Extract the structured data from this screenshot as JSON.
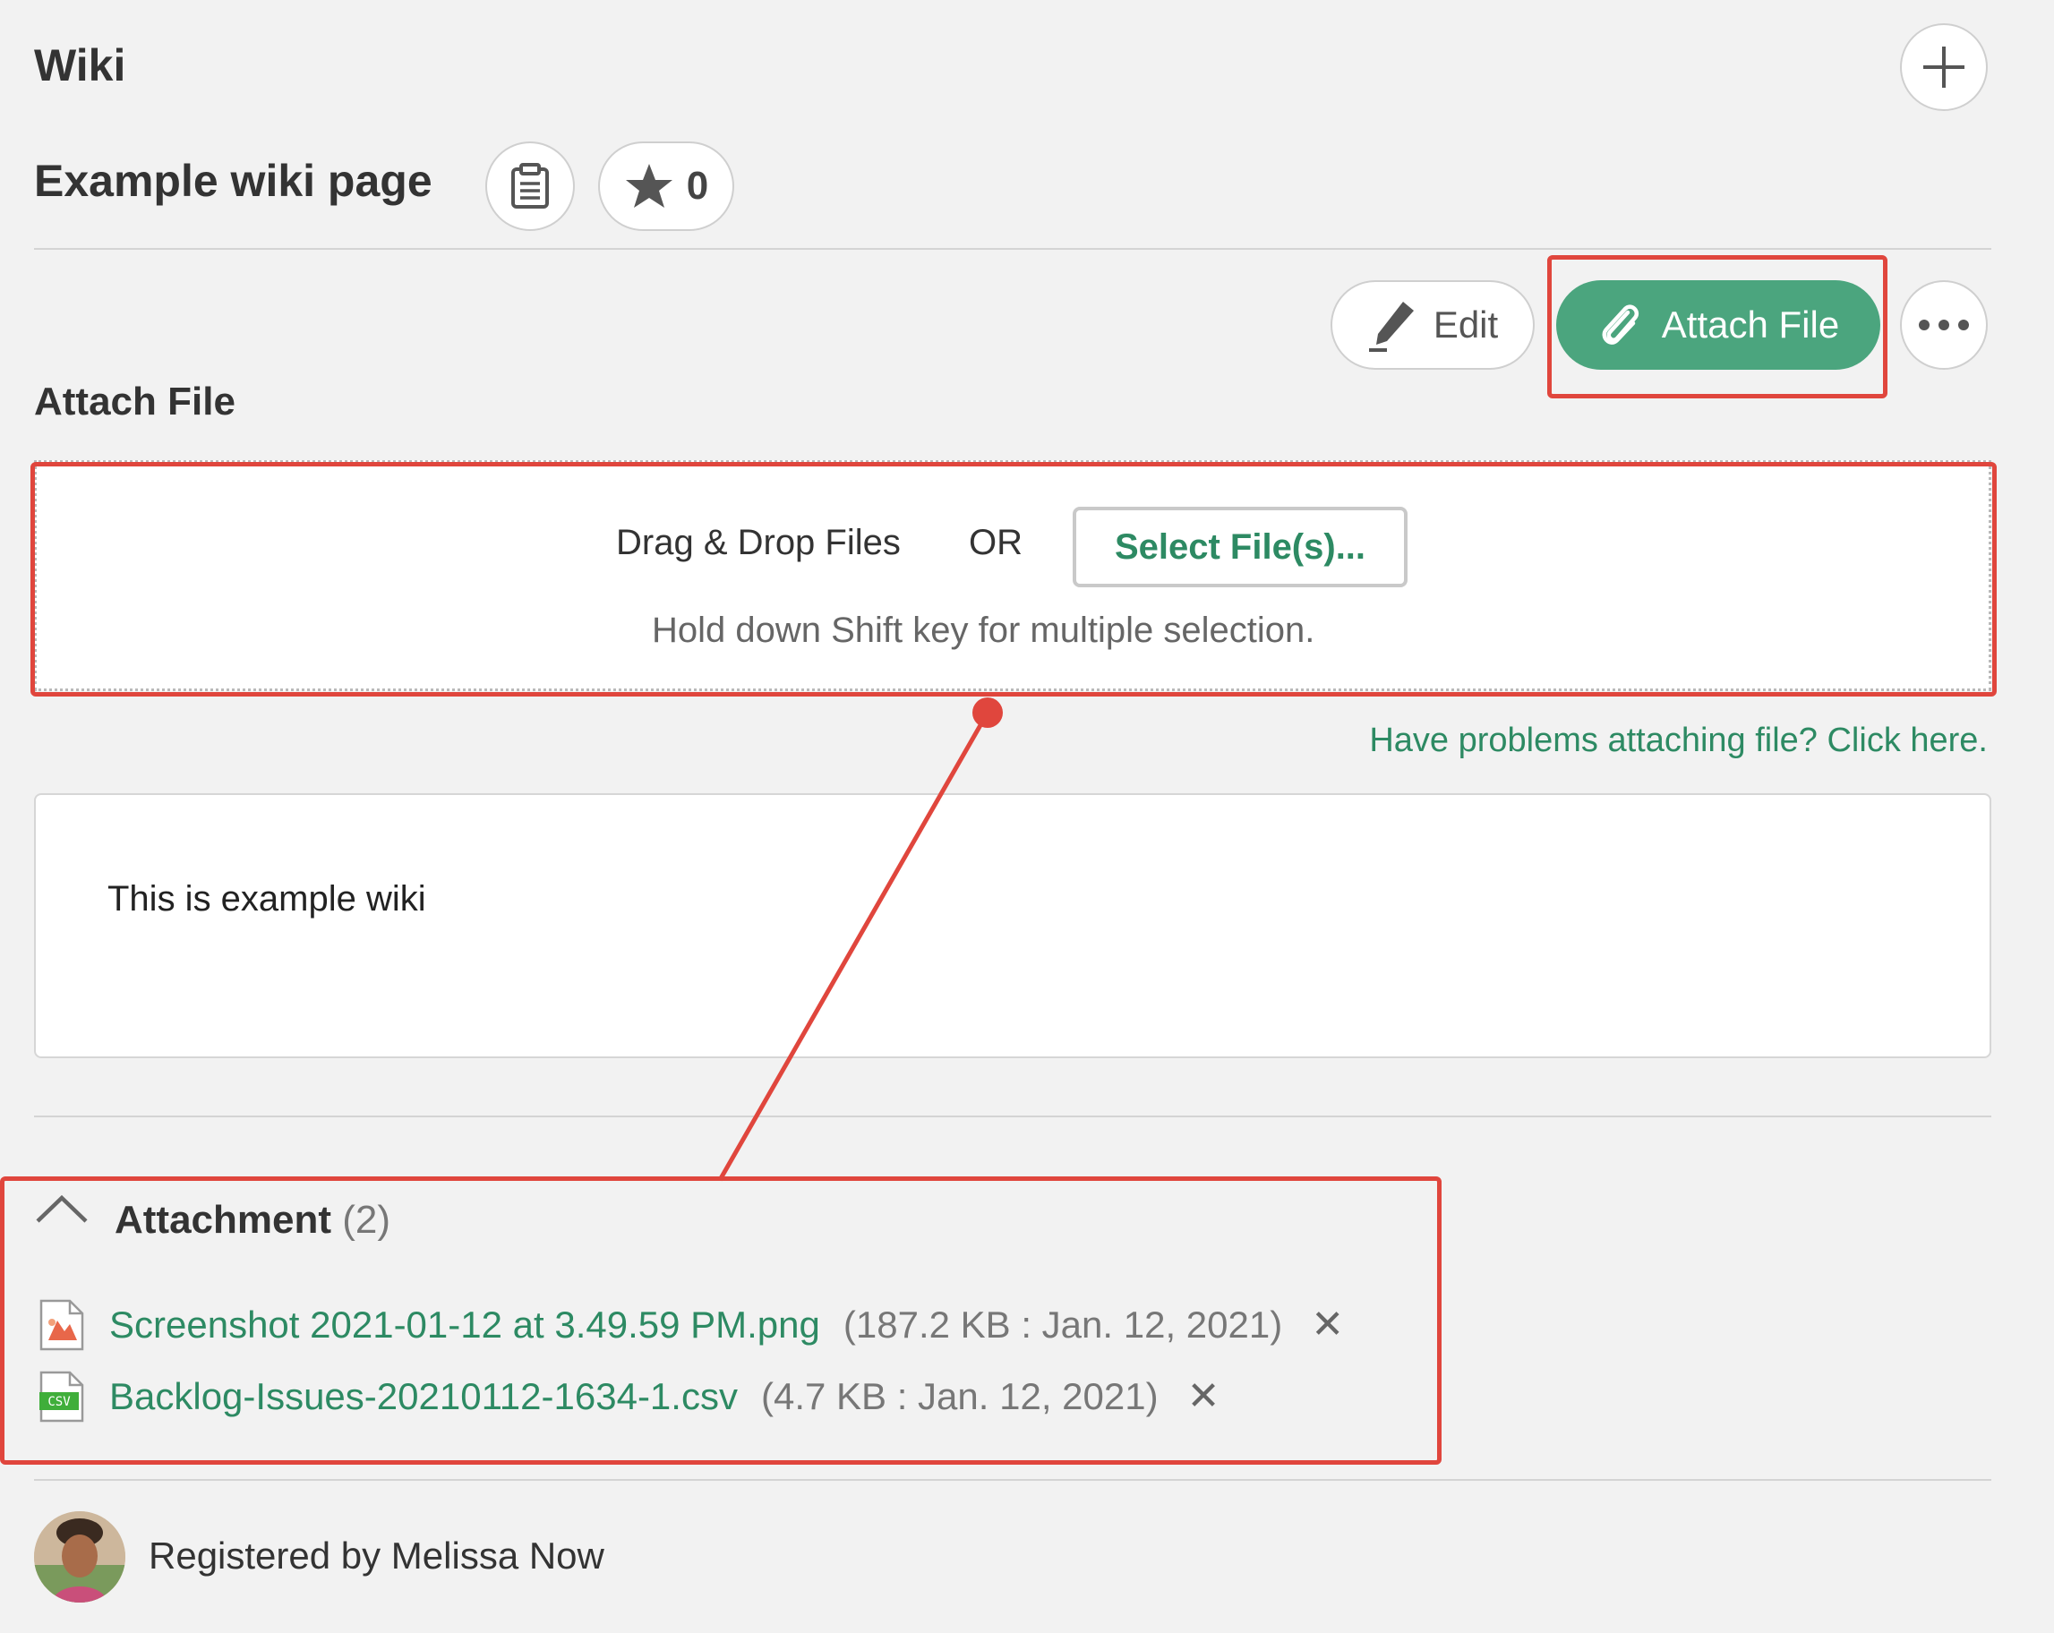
{
  "header": {
    "section_title": "Wiki",
    "page_title": "Example wiki page",
    "star_count": "0"
  },
  "toolbar": {
    "edit_label": "Edit",
    "attach_label": "Attach File"
  },
  "attach_section": {
    "title": "Attach File",
    "drag_drop": "Drag & Drop Files",
    "or": "OR",
    "select_label": "Select File(s)...",
    "hint": "Hold down Shift key for multiple selection.",
    "problem_link": "Have problems attaching file? Click here."
  },
  "content": {
    "text": "This is example wiki"
  },
  "attachments": {
    "heading": "Attachment",
    "count": "(2)",
    "files": [
      {
        "name": "Screenshot 2021-01-12 at 3.49.59 PM.png",
        "meta": "(187.2 KB : Jan. 12, 2021)",
        "type": "image"
      },
      {
        "name": "Backlog-Issues-20210112-1634-1.csv",
        "meta": "(4.7 KB : Jan. 12, 2021)",
        "type": "csv",
        "badge": "CSV"
      }
    ]
  },
  "footer": {
    "registered": "Registered by Melissa Now"
  },
  "colors": {
    "accent": "#4ba57e",
    "link": "#2d8a63",
    "annotation": "#e0463d"
  }
}
